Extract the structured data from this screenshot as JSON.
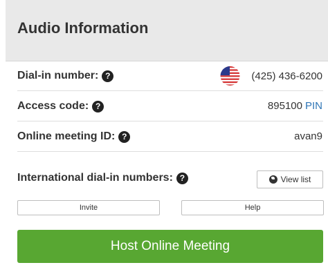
{
  "panel": {
    "title": "Audio Information"
  },
  "rows": {
    "dial_in": {
      "label": "Dial-in number:",
      "value": "(425) 436-6200"
    },
    "access_code": {
      "label": "Access code:",
      "value": "895100",
      "link": "PIN"
    },
    "meeting_id": {
      "label": "Online meeting ID:",
      "value": "avan9"
    },
    "international": {
      "label": "International dial-in numbers:",
      "button": "View list"
    }
  },
  "help_icon_glyph": "?",
  "buttons": {
    "invite": "Invite",
    "help": "Help",
    "host": "Host Online Meeting"
  },
  "icons": {
    "flag": "us-flag-icon",
    "help": "question-circle-icon",
    "globe": "globe-icon"
  },
  "colors": {
    "host_button": "#58a732",
    "link": "#2e75b6",
    "header_bg": "#e9e9e9"
  }
}
